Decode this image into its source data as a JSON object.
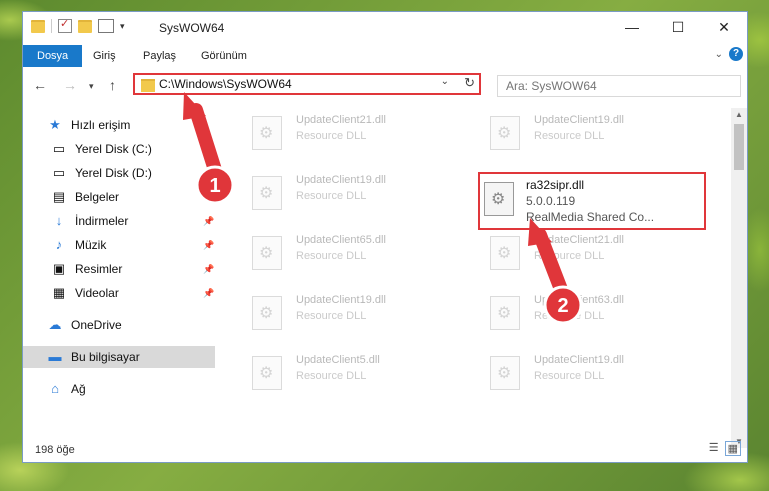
{
  "window": {
    "title": "SysWOW64"
  },
  "ribbon": {
    "tabs": [
      "Dosya",
      "Giriş",
      "Paylaş",
      "Görünüm"
    ]
  },
  "address": {
    "path": "C:\\Windows\\SysWOW64"
  },
  "search": {
    "placeholder": "Ara: SysWOW64"
  },
  "sidebar": {
    "items": [
      {
        "label": "Hızlı erişim",
        "icon": "star-icon",
        "pinned": false
      },
      {
        "label": "Yerel Disk (C:)",
        "icon": "drive-icon",
        "pinned": false
      },
      {
        "label": "Yerel Disk (D:)",
        "icon": "drive-icon",
        "pinned": false
      },
      {
        "label": "Belgeler",
        "icon": "document-icon",
        "pinned": false
      },
      {
        "label": "İndirmeler",
        "icon": "download-icon",
        "pinned": true
      },
      {
        "label": "Müzik",
        "icon": "music-icon",
        "pinned": true
      },
      {
        "label": "Resimler",
        "icon": "picture-icon",
        "pinned": true
      },
      {
        "label": "Videolar",
        "icon": "video-icon",
        "pinned": true
      },
      {
        "label": "OneDrive",
        "icon": "cloud-icon",
        "pinned": false
      },
      {
        "label": "Bu bilgisayar",
        "icon": "computer-icon",
        "pinned": false,
        "selected": true
      },
      {
        "label": "Ağ",
        "icon": "network-icon",
        "pinned": false
      }
    ]
  },
  "files": [
    {
      "name": "UpdateClient21.dll",
      "type": "Resource DLL"
    },
    {
      "name": "UpdateClient19.dll",
      "type": "Resource DLL"
    },
    {
      "name": "UpdateClient19.dll",
      "type": "Resource DLL"
    },
    {
      "name": "ra32sipr.dll",
      "version": "5.0.0.119",
      "description": "RealMedia Shared Co...",
      "highlighted": true
    },
    {
      "name": "UpdateClient65.dll",
      "type": "Resource DLL"
    },
    {
      "name": "UpdateClient21.dll",
      "type": "Resource DLL"
    },
    {
      "name": "UpdateClient19.dll",
      "type": "Resource DLL"
    },
    {
      "name": "UpdateClient63.dll",
      "type": "Resource DLL"
    },
    {
      "name": "UpdateClient5.dll",
      "type": "Resource DLL"
    },
    {
      "name": "UpdateClient19.dll",
      "type": "Resource DLL"
    }
  ],
  "status": {
    "count": "198 öğe"
  },
  "callouts": {
    "one": "1",
    "two": "2"
  },
  "colors": {
    "accent": "#1979ca",
    "highlight": "#e0363a"
  }
}
